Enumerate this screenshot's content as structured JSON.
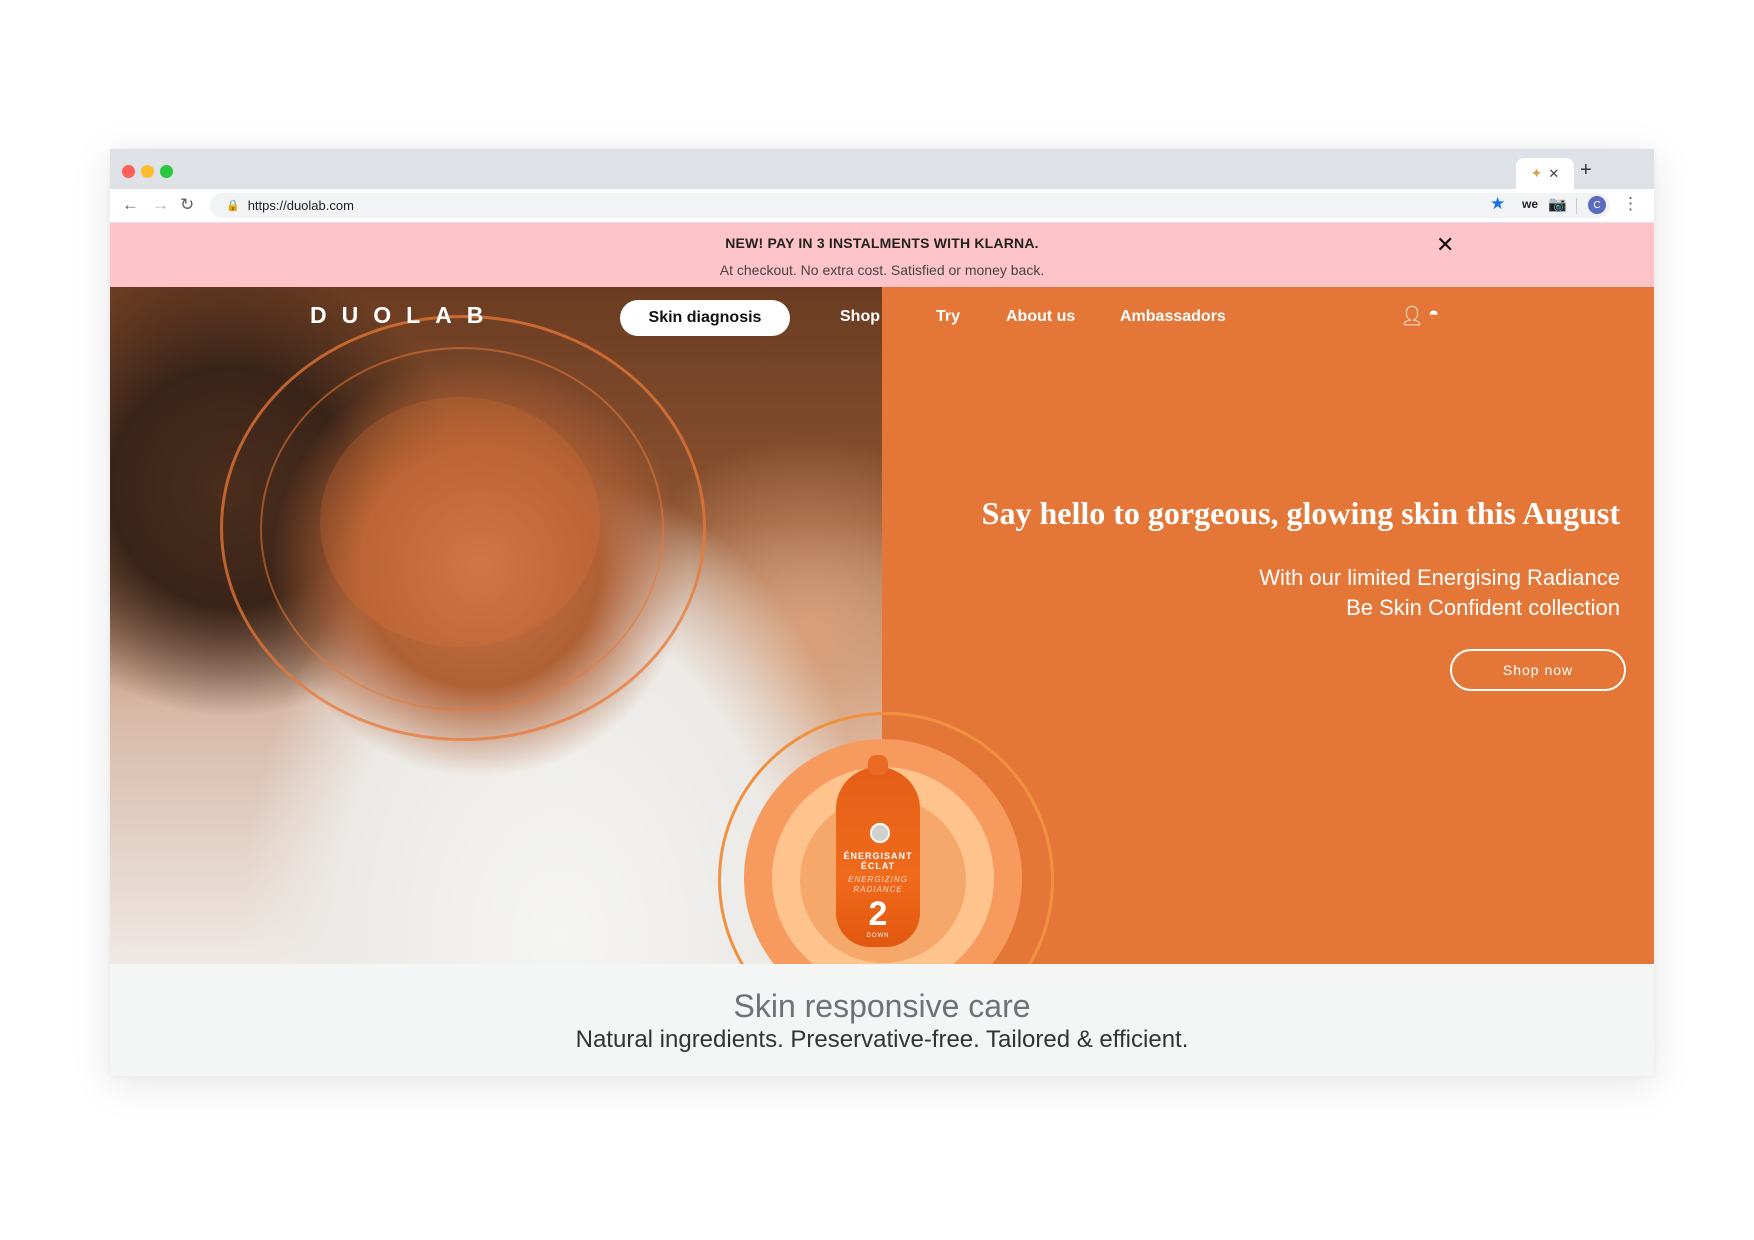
{
  "browser": {
    "tab_close": "✕",
    "new_tab": "+",
    "url": "https://duolab.com",
    "ext_label": "we"
  },
  "promo": {
    "title": "NEW! PAY IN 3 INSTALMENTS WITH KLARNA.",
    "subtitle": "At checkout. No extra cost. Satisfied or money back.",
    "close": "✕"
  },
  "site": {
    "logo": "DUOLAB",
    "nav": {
      "primary": "Skin diagnosis",
      "items": [
        "Shop",
        "Try",
        "About us",
        "Ambassadors"
      ]
    }
  },
  "hero": {
    "headline": "Say hello to gorgeous, glowing skin this August",
    "sub_line1": "With our limited Energising Radiance",
    "sub_line2": "Be Skin Confident collection",
    "cta": "Shop now"
  },
  "product": {
    "line1": "ÉNERGISANT",
    "line2": "ÉCLAT",
    "line3": "ENERGIZING",
    "line4": "RADIANCE",
    "number": "2",
    "down": "DOWN"
  },
  "tagline": {
    "title": "Skin responsive care",
    "subtitle": "Natural ingredients. Preservative-free. Tailored & efficient."
  },
  "colors": {
    "accent_orange": "#e47737",
    "promo_pink": "#ffc4c9",
    "tagline_bg": "#f4f6f6"
  }
}
